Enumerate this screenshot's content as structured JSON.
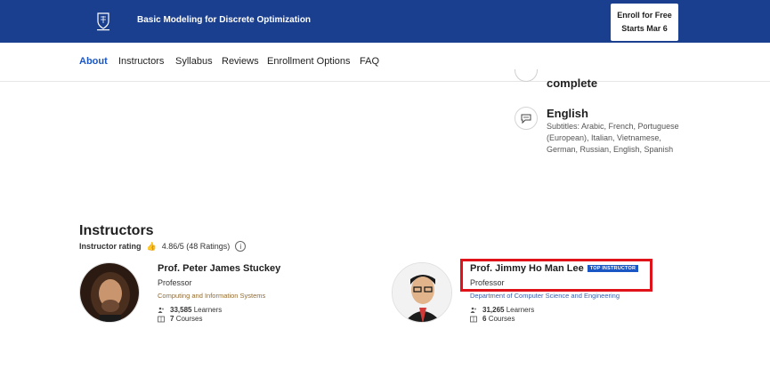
{
  "header": {
    "course_title": "Basic Modeling for Discrete Optimization",
    "enroll_line1": "Enroll for Free",
    "enroll_line2": "Starts Mar 6",
    "brand_color": "#1b3f8f"
  },
  "nav": {
    "tabs": [
      {
        "label": "About",
        "active": true
      },
      {
        "label": "Instructors"
      },
      {
        "label": "Syllabus"
      },
      {
        "label": "Reviews"
      },
      {
        "label": "Enrollment Options"
      },
      {
        "label": "FAQ"
      }
    ]
  },
  "details": {
    "complete_text": "complete",
    "language": "English",
    "subtitles": "Subtitles: Arabic, French, Portuguese (European), Italian, Vietnamese, German, Russian, English, Spanish"
  },
  "instructors": {
    "title": "Instructors",
    "rating_label": "Instructor rating",
    "rating_value": "4.86/5 (48 Ratings)",
    "list": [
      {
        "name": "Prof. Peter James Stuckey",
        "role": "Professor",
        "department": "Computing and Information Systems",
        "learners": "33,585",
        "learners_label": "Learners",
        "courses": "7",
        "courses_label": "Courses"
      },
      {
        "name": "Prof. Jimmy Ho Man Lee",
        "badge": "TOP INSTRUCTOR",
        "role": "Professor",
        "department": "Department of Computer Science and Engineering",
        "learners": "31,265",
        "learners_label": "Learners",
        "courses": "6",
        "courses_label": "Courses"
      }
    ]
  }
}
